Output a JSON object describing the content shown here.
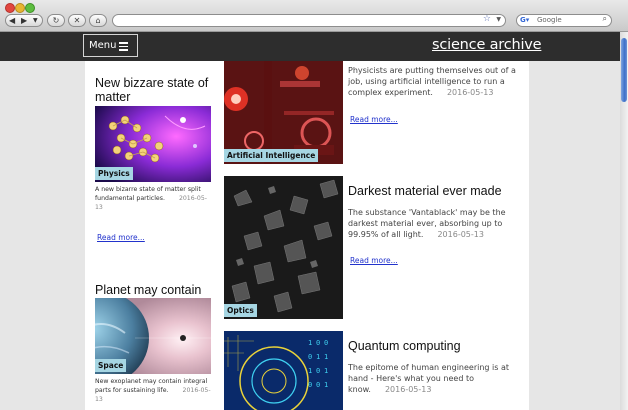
{
  "browser": {
    "search_placeholder": "Google",
    "back_icon": "◀",
    "forward_icon": "▶"
  },
  "header": {
    "menu_label": "Menu",
    "site_title": "science archive"
  },
  "left_column": [
    {
      "title": "New bizzare state of matter",
      "tag": "Physics",
      "excerpt": "A new bizarre state of matter split fundamental particles.",
      "date": "2016-05-13",
      "read_more": "Read more..."
    },
    {
      "title": "Planet may contain life",
      "tag": "Space",
      "excerpt": "New exoplanet may contain integral parts for sustaining life.",
      "date": "2016-05-13"
    }
  ],
  "right_column": [
    {
      "tag": "Artificial Intelligence",
      "excerpt": "Physicists are putting themselves out of a job, using artificial intelligence to run a complex experiment.",
      "date": "2016-05-13",
      "read_more": "Read more..."
    },
    {
      "title": "Darkest material ever made",
      "tag": "Optics",
      "excerpt": "The substance 'Vantablack' may be the darkest material ever, absorbing up to 99.95% of all light.",
      "date": "2016-05-13",
      "read_more": "Read more..."
    },
    {
      "title": "Quantum computing",
      "excerpt": "The epitome of human engineering is at hand - Here's what you need to know.",
      "date": "2016-05-13"
    }
  ],
  "colors": {
    "header_bg": "#2d2d2d",
    "tag_bg": "#a6d6e3",
    "link": "#2233cc"
  }
}
